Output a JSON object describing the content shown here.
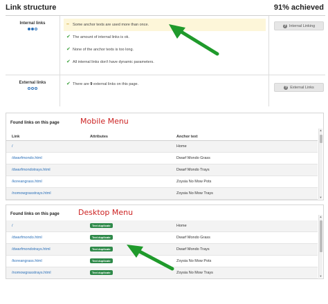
{
  "header": {
    "title": "Link structure",
    "score": "91% achieved"
  },
  "internal": {
    "label": "Internal links",
    "dots_filled": 2,
    "dots_total": 3,
    "checks": [
      {
        "status": "warning",
        "text": "Some anchor texts are used more than once."
      },
      {
        "status": "ok",
        "text": "The amount of internal links is ok."
      },
      {
        "status": "ok",
        "text": "None of the anchor texts is too long."
      },
      {
        "status": "ok",
        "text": "All internal links don't have dynamic parameters."
      }
    ],
    "button": "Internal Linking"
  },
  "external": {
    "label": "External links",
    "dots_filled": 0,
    "dots_total": 3,
    "check": {
      "pre": "There are ",
      "count": "9",
      "post": " external links on this page."
    },
    "button": "External Links"
  },
  "mobile_panel": {
    "title": "Found links on this page",
    "annotation": "Mobile Menu",
    "columns": {
      "link": "Link",
      "attributes": "Attributes",
      "anchor": "Anchor text"
    },
    "rows": [
      {
        "link": "/",
        "attr": "",
        "anchor": "Home"
      },
      {
        "link": "/dwarfmondo.html",
        "attr": "",
        "anchor": "Dwarf Mondo Grass"
      },
      {
        "link": "/dwarfmondotrays.html",
        "attr": "",
        "anchor": "Dwarf Mondo Trays"
      },
      {
        "link": "/koreangrass.html",
        "attr": "",
        "anchor": "Zoysia No Mow Pots"
      },
      {
        "link": "/nomowgrasstrays.html",
        "attr": "",
        "anchor": "Zoysia No Mow Trays"
      }
    ]
  },
  "desktop_panel": {
    "title": "Found links on this page",
    "annotation": "Desktop Menu",
    "rows": [
      {
        "link": "/",
        "attr": "Text duplicate",
        "anchor": "Home"
      },
      {
        "link": "/dwarfmondo.html",
        "attr": "Text duplicate",
        "anchor": "Dwarf Mondo Grass"
      },
      {
        "link": "/dwarfmondotrays.html",
        "attr": "Text duplicate",
        "anchor": "Dwarf Mondo Trays"
      },
      {
        "link": "/koreangrass.html",
        "attr": "Text duplicate",
        "anchor": "Zoysia No Mow Pots"
      },
      {
        "link": "/nomowgrasstrays.html",
        "attr": "Text duplicate",
        "anchor": "Zoysia No Mow Trays"
      }
    ]
  },
  "colors": {
    "annotation_red": "#cc2222",
    "arrow_green": "#1f9a2b",
    "badge_green": "#2f8a4a",
    "link_blue": "#2a6fb8"
  },
  "icons": {
    "ok": "check-icon",
    "warning": "minus-icon",
    "button": "info-circle-icon",
    "arrow": "green-arrow-icon"
  }
}
